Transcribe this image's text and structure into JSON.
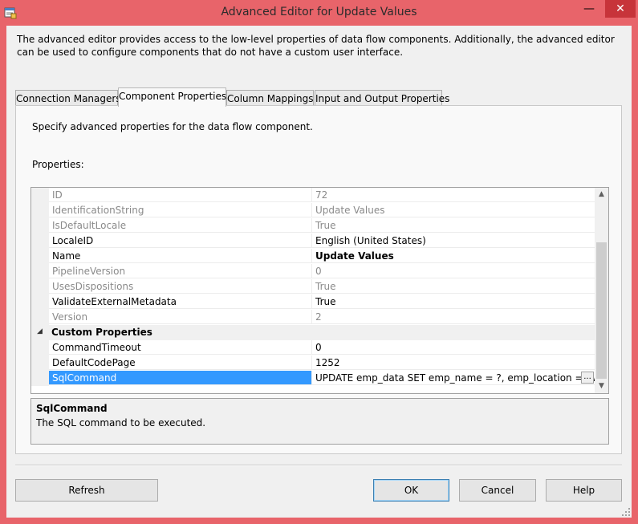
{
  "window": {
    "title": "Advanced Editor for Update Values"
  },
  "titlebar_buttons": {
    "minimize": "—",
    "close": "✕"
  },
  "description": "The advanced editor provides access to the low-level properties of data flow components. Additionally, the advanced editor can be used to configure components that do not have a custom user interface.",
  "tabs": [
    {
      "label": "Connection Managers"
    },
    {
      "label": "Component Properties"
    },
    {
      "label": "Column Mappings"
    },
    {
      "label": "Input and Output Properties"
    }
  ],
  "panel": {
    "description": "Specify advanced properties for the data flow component.",
    "properties_label": "Properties:"
  },
  "properties": [
    {
      "name": "ID",
      "value": "72"
    },
    {
      "name": "IdentificationString",
      "value": "Update Values"
    },
    {
      "name": "IsDefaultLocale",
      "value": "True"
    },
    {
      "name": "LocaleID",
      "value": "English (United States)"
    },
    {
      "name": "Name",
      "value": "Update Values"
    },
    {
      "name": "PipelineVersion",
      "value": "0"
    },
    {
      "name": "UsesDispositions",
      "value": "True"
    },
    {
      "name": "ValidateExternalMetadata",
      "value": "True"
    },
    {
      "name": "Version",
      "value": "2"
    }
  ],
  "custom_category": {
    "label": "Custom Properties",
    "expand_glyph": "◢"
  },
  "custom_properties": [
    {
      "name": "CommandTimeout",
      "value": "0"
    },
    {
      "name": "DefaultCodePage",
      "value": "1252"
    },
    {
      "name": "SqlCommand",
      "value": "UPDATE emp_data SET emp_name = ?, emp_location = ?WHERE",
      "ellipsis": "..."
    }
  ],
  "scrollbar": {
    "up": "▲",
    "down": "▼"
  },
  "help": {
    "title": "SqlCommand",
    "description": "The SQL command to be executed."
  },
  "buttons": {
    "refresh": "Refresh",
    "ok": "OK",
    "cancel": "Cancel",
    "help": "Help"
  },
  "colors": {
    "titlebar": "#e8646a",
    "close_button": "#c7343a",
    "selection": "#3399ff"
  }
}
